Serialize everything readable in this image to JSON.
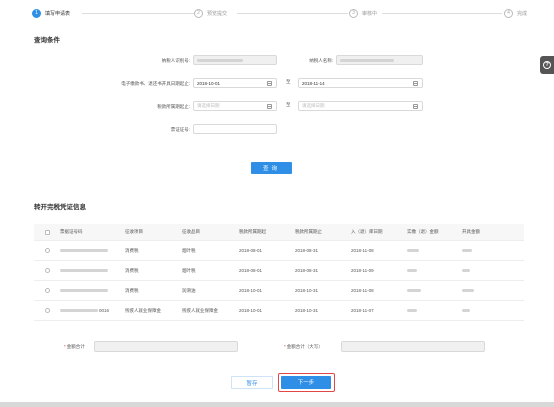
{
  "steps": [
    {
      "num": "1",
      "label": "填写申请表",
      "active": true
    },
    {
      "num": "2",
      "label": "预览提交",
      "active": false
    },
    {
      "num": "3",
      "label": "审核中",
      "active": false
    },
    {
      "num": "4",
      "label": "完成",
      "active": false
    }
  ],
  "help_icon": "?",
  "query": {
    "title": "查询条件",
    "taxpayer_id_label": "纳税人识别号:",
    "taxpayer_name_label": "纳税人名称:",
    "ticket_date_label": "电子缴款书、退还书开具日期起止:",
    "ticket_date_from": "2018-10-01",
    "ticket_date_to": "2018-11-14",
    "range_sep": "至",
    "period_label": "税款所属期起止:",
    "period_from_placeholder": "请选择日期",
    "period_to_placeholder": "请选择日期",
    "cert_no_label": "票证证号:",
    "query_button": "查询"
  },
  "transfer": {
    "title": "转开完税凭证信息",
    "columns": [
      "",
      "票据证号码",
      "征收项目",
      "征收品目",
      "税款所属期起",
      "税款所属期止",
      "入（退）库日期",
      "实缴（退）金额",
      "开具金额"
    ],
    "rows": [
      {
        "cert": "",
        "item": "消费税",
        "subitem": "烟叶税",
        "from": "2018-08-01",
        "to": "2018-08-31",
        "date": "2018-11-08"
      },
      {
        "cert": "",
        "item": "消费税",
        "subitem": "烟叶税",
        "from": "2018-08-01",
        "to": "2018-08-31",
        "date": "2018-11-09"
      },
      {
        "cert": "",
        "item": "消费税",
        "subitem": "润滑油",
        "from": "2018-10-01",
        "to": "2018-10-31",
        "date": "2018-11-08"
      },
      {
        "cert": "0016",
        "item": "残疾人就业保障金",
        "subitem": "残疾人就业保障金",
        "from": "2018-10-01",
        "to": "2018-10-31",
        "date": "2018-11-07"
      }
    ],
    "sum_label": "金额合计",
    "sum_upper_label": "金额合计（大写）",
    "required_mark": "*"
  },
  "actions": {
    "save": "暂存",
    "next": "下一步"
  },
  "colors": {
    "primary": "#2f8fe6",
    "highlight": "#e04848"
  }
}
